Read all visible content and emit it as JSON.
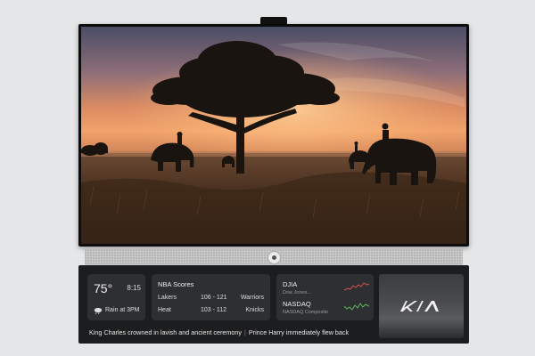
{
  "weather": {
    "temperature": "75°",
    "time": "8:15",
    "forecast": "Rain at 3PM"
  },
  "nba": {
    "title": "NBA Scores",
    "games": [
      {
        "team_a": "Lakers",
        "score": "106 - 121",
        "team_b": "Warriors"
      },
      {
        "team_a": "Heat",
        "score": "103 - 112",
        "team_b": "Knicks"
      }
    ]
  },
  "stocks": [
    {
      "name": "DJIA",
      "subtitle": "Dow Jones...",
      "trend_color": "#d9534f"
    },
    {
      "name": "NASDAQ",
      "subtitle": "NASDAQ Composite",
      "trend_color": "#5cb85c"
    }
  ],
  "ticker": {
    "headline_1": "King Charles crowned in lavish and ancient ceremony",
    "separator": "|",
    "headline_2": "Prince Harry immediately flew back"
  },
  "ad": {
    "brand": "KIA"
  },
  "colors": {
    "panel": "#1c1d1f",
    "widget": "#2e2f32",
    "sunset": "#e8875a"
  }
}
